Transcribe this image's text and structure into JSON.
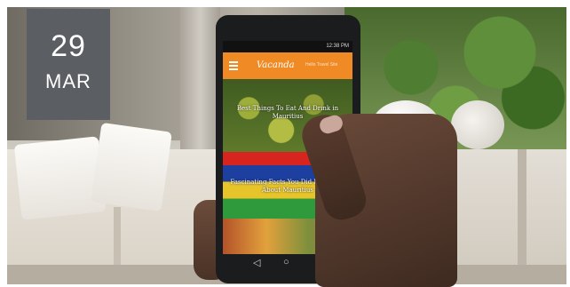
{
  "date": {
    "day": "29",
    "month": "MAR"
  },
  "phone": {
    "status_time": "12:38 PM",
    "app_name": "Vacanda",
    "app_subtitle": "Hello Travel Site",
    "articles": [
      {
        "title": "Best Things To Eat And Drink in Mauritius"
      },
      {
        "title": "Fascinating Facts You Did Not Know About Mauritius"
      }
    ],
    "nav_icons": [
      "back-icon",
      "home-icon",
      "recent-apps-icon"
    ]
  },
  "colors": {
    "app_bar": "#f08a25",
    "date_badge": "#5b5e62"
  }
}
